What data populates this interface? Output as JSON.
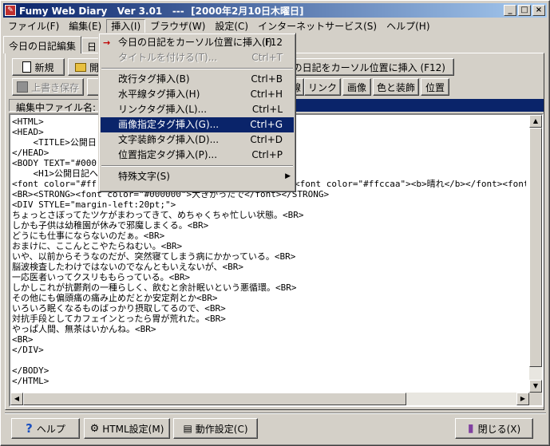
{
  "window": {
    "app_icon": "diary-icon",
    "title": "Fumy Web Diary   Ver 3.01   ---  [2000年2月10日木曜日]",
    "controls": {
      "minimize": "_",
      "maximize": "□",
      "close": "×"
    }
  },
  "menubar": [
    "ファイル(F)",
    "編集(E)",
    "挿入(I)",
    "ブラウザ(W)",
    "設定(C)",
    "インターネットサービス(S)",
    "ヘルプ(H)"
  ],
  "tabs": [
    "今日の日記編集",
    "日"
  ],
  "toolbar": {
    "new": "新規",
    "open": "開",
    "insert_today": "今日の日記をカーソル位置に挿入 (F12)",
    "overwrite_save": "上書き保存",
    "row2_buttons": [
      "線",
      "リンク",
      "画像",
      "色と装飾",
      "位置"
    ]
  },
  "filebar": {
    "label": "編集中ファイル名:",
    "value": ""
  },
  "editor": {
    "lines": [
      "<HTML>",
      "<HEAD>",
      "    <TITLE>公開日",
      "</HEAD>",
      "<BODY TEXT=\"#000",
      "    <H1>公開日記へ",
      "<font color=\"#ff",
      "<BR><STRONG><font color=\"#000000\">大きかったで</font></STRONG>",
      "<DIV STYLE=\"margin-left:20pt;\">",
      "ちょっとさぼってたツケがまわってきて、めちゃくちゃ忙しい状態。<BR>",
      "しかも子供は幼稚園が休みで邪魔しまくる。<BR>",
      "どうにも仕事にならないのだぁ。<BR>",
      "おまけに、ここんとこやたらねむい。<BR>",
      "いや、以前からそうなのだが、突然寝てしまう病にかかっている。<BR>",
      "脳波検査したわけではないのでなんともいえないが、<BR>",
      "一応医者いってクスリももらっている。<BR>",
      "しかしこれが抗鬱剤の一種らしく、飲むと余計眠いという悪循環。<BR>",
      "その他にも偏頭痛の痛み止めだとか安定剤とか<BR>",
      "いろいろ眠くなるものばっかり摂取してるので、<BR>",
      "対抗手段としてカフェインとったら胃が荒れた。<BR>",
      "やっぱ人間、無茶はいかんね。<BR>",
      "<BR>",
      "</DIV>",
      "",
      "</BODY>",
      "</HTML>"
    ],
    "right_overflow_text": "<font color=\"#ffccaa\"><b>晴れ</b></font><font"
  },
  "insert_menu": {
    "items": [
      {
        "label": "今日の日記をカーソル位置に挿入(I)",
        "shortcut": "F12"
      },
      {
        "label": "タイトルを付ける(T)...",
        "shortcut": "Ctrl+T",
        "disabled": true
      },
      {
        "separator": true
      },
      {
        "label": "改行タグ挿入(B)",
        "shortcut": "Ctrl+B"
      },
      {
        "label": "水平線タグ挿入(H)",
        "shortcut": "Ctrl+H"
      },
      {
        "label": "リンクタグ挿入(L)...",
        "shortcut": "Ctrl+L"
      },
      {
        "label": "画像指定タグ挿入(G)...",
        "shortcut": "Ctrl+G",
        "highlighted": true
      },
      {
        "label": "文字装飾タグ挿入(D)...",
        "shortcut": "Ctrl+D"
      },
      {
        "label": "位置指定タグ挿入(P)...",
        "shortcut": "Ctrl+P"
      },
      {
        "separator": true
      },
      {
        "label": "特殊文字(S)",
        "submenu": true
      }
    ]
  },
  "bottom": {
    "help": "ヘルプ",
    "html_settings": "HTML設定(M)",
    "behavior_settings": "動作設定(C)",
    "close": "閉じる(X)"
  },
  "colors": {
    "titlebar_start": "#0a246a",
    "titlebar_end": "#a6caf0",
    "highlight": "#0a246a",
    "face": "#d4d0c8"
  }
}
